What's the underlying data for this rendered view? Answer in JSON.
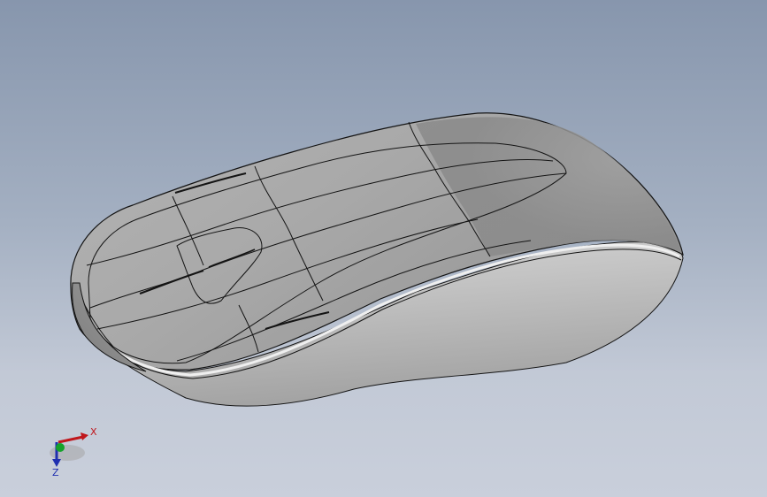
{
  "viewport": {
    "background_top": "#8796ad",
    "background_bottom": "#c9cfdb"
  },
  "model": {
    "body_color": "#b4b4b4",
    "edge_color": "#141414"
  },
  "triad": {
    "x_label": "X",
    "z_label": "Z",
    "x_color": "#c0171c",
    "y_color": "#15a22a",
    "z_color": "#1f2fb0"
  }
}
